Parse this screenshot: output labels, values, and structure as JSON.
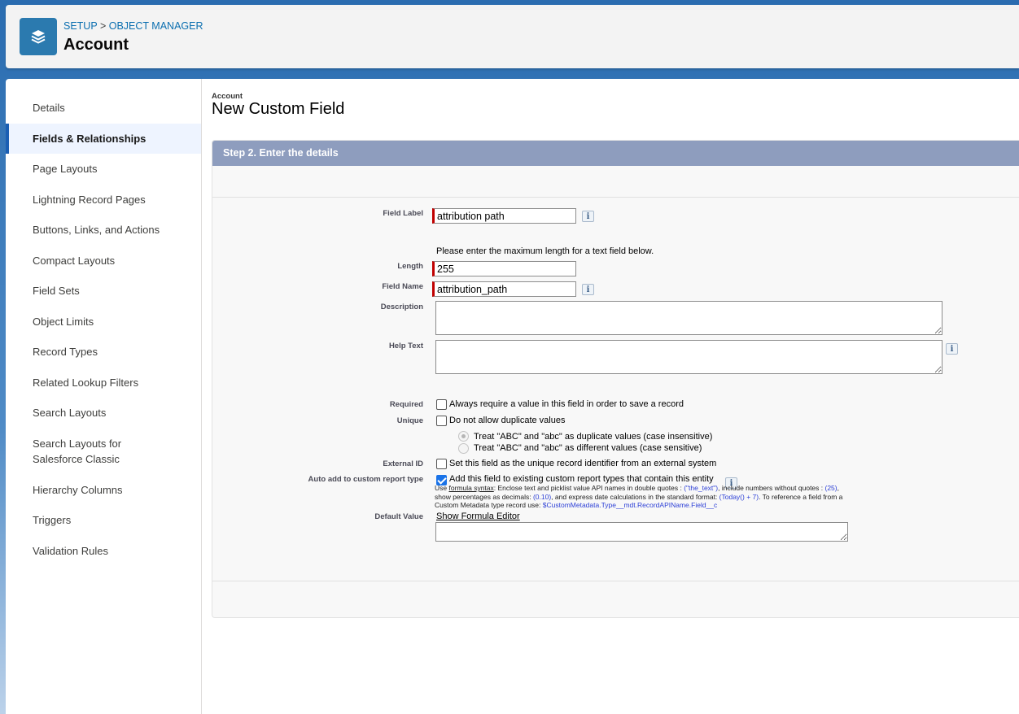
{
  "header": {
    "breadcrumb_setup": "SETUP",
    "breadcrumb_sep": ">",
    "breadcrumb_object_manager": "OBJECT MANAGER",
    "title": "Account",
    "icon": "layers-icon"
  },
  "sidebar": {
    "items": [
      {
        "label": "Details"
      },
      {
        "label": "Fields & Relationships",
        "active": true
      },
      {
        "label": "Page Layouts"
      },
      {
        "label": "Lightning Record Pages"
      },
      {
        "label": "Buttons, Links, and Actions"
      },
      {
        "label": "Compact Layouts"
      },
      {
        "label": "Field Sets"
      },
      {
        "label": "Object Limits"
      },
      {
        "label": "Record Types"
      },
      {
        "label": "Related Lookup Filters"
      },
      {
        "label": "Search Layouts"
      },
      {
        "label": "Search Layouts for Salesforce Classic"
      },
      {
        "label": "Hierarchy Columns"
      },
      {
        "label": "Triggers"
      },
      {
        "label": "Validation Rules"
      }
    ]
  },
  "form": {
    "object_label": "Account",
    "title": "New Custom Field",
    "step_title": "Step 2. Enter the details",
    "field_label": {
      "label": "Field Label",
      "value": "attribution path"
    },
    "length_note": "Please enter the maximum length for a text field below.",
    "length": {
      "label": "Length",
      "value": "255"
    },
    "field_name": {
      "label": "Field Name",
      "value": "attribution_path"
    },
    "description": {
      "label": "Description",
      "value": ""
    },
    "help_text": {
      "label": "Help Text",
      "value": ""
    },
    "required": {
      "label": "Required",
      "text": "Always require a value in this field in order to save a record",
      "checked": false
    },
    "unique": {
      "label": "Unique",
      "text": "Do not allow duplicate values",
      "checked": false
    },
    "unique_option_insensitive": "Treat \"ABC\" and \"abc\" as duplicate values (case insensitive)",
    "unique_option_sensitive": "Treat \"ABC\" and \"abc\" as different values (case sensitive)",
    "external_id": {
      "label": "External ID",
      "text": "Set this field as the unique record identifier from an external system",
      "checked": false
    },
    "auto_add": {
      "label": "Auto add to custom report type",
      "text": "Add this field to existing custom report types that contain this entity",
      "checked": true
    },
    "default_value": {
      "label": "Default Value",
      "link": "Show Formula Editor",
      "value": ""
    },
    "help": {
      "use": "Use ",
      "formula_syntax": "formula syntax",
      "part1": ": Enclose text and picklist value API names in double quotes : ",
      "ex_text": "(\"the_text\")",
      "part2": ", include numbers without quotes : ",
      "ex_num": "(25)",
      "part3": ", show percentages as decimals: ",
      "ex_pct": "(0.10)",
      "part4": ", and express date calculations in the standard format: ",
      "ex_date": "(Today() + 7)",
      "part5": ". To reference a field from a Custom Metadata type record use: ",
      "ex_mdt": "$CustomMetadata.Type__mdt.RecordAPIName.Field__c"
    }
  }
}
